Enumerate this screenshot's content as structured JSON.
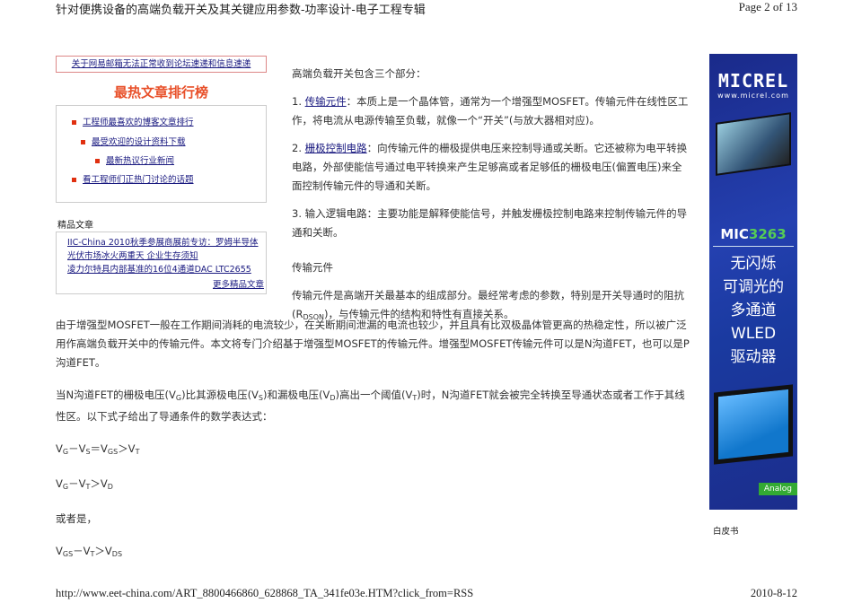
{
  "header": {
    "title": "针对便携设备的高端负载开关及其关键应用参数-功率设计-电子工程专辑",
    "page": "Page 2 of 13"
  },
  "footer": {
    "url": "http://www.eet-china.com/ART_8800466860_628868_TA_341fe03e.HTM?click_from=RSS",
    "date": "2010-8-12"
  },
  "sidebar": {
    "notice": "关于网易邮箱无法正常收到论坛速递和信息速递",
    "hot_title": "最热文章排行榜",
    "hot_items": [
      "工程师最喜欢的博客文章排行",
      "最受欢迎的设计资料下载",
      "最新热议行业新闻",
      "看工程师们正热门讨论的话题"
    ],
    "featured_label": "精品文章",
    "featured_items": [
      "IIC-China 2010秋季参展商展前专访：罗姆半导体",
      "光伏市场冰火两重天 企业生存须知",
      "凌力尔特具内部基准的16位4通道DAC LTC2655"
    ],
    "more_link": "更多精品文章"
  },
  "main": {
    "intro": "高端负载开关包含三个部分：",
    "p1_num": "1. ",
    "p1_link": "传输元件",
    "p1_text": "：本质上是一个晶体管，通常为一个增强型MOSFET。传输元件在线性区工作，将电流从电源传输至负载，就像一个“开关”(与放大器相对应)。",
    "p2_num": "2. ",
    "p2_link": "栅极控制电路",
    "p2_text": "：向传输元件的栅极提供电压来控制导通或关断。它还被称为电平转换电路，外部使能信号通过电平转换来产生足够高或者足够低的栅极电压(偏置电压)来全面控制传输元件的导通和关断。",
    "p3": "3. 输入逻辑电路：主要功能是解释使能信号，并触发栅极控制电路来控制传输元件的导通和关断。",
    "heading": "传输元件",
    "p4a": "传输元件是高端开关最基本的组成部分。最经常考虑的参数，特别是开关导通时的阻抗(R",
    "p4sub": "DSON",
    "p4b": ")，与传输元件的结构和特性有直接关系。",
    "p5": "由于增强型MOSFET一般在工作期间消耗的电流较少，在关断期间泄漏的电流也较少，并且具有比双极晶体管更高的热稳定性，所以被广泛用作高端负载开关中的传输元件。本文将专门介绍基于增强型MOSFET的传输元件。增强型MOSFET传输元件可以是N沟道FET，也可以是P沟道FET。",
    "p6": [
      "当N沟道FET的栅极电压(V",
      "G",
      ")比其源极电压(V",
      "S",
      ")和漏极电压(V",
      "D",
      ")高出一个阈值(V",
      "T",
      ")时，N沟道FET就会被完全转换至导通状态或者工作于其线性区。以下式子给出了导通条件的数学表达式："
    ],
    "f1": [
      "V",
      "G",
      "－V",
      "S",
      "＝V",
      "GS",
      "＞V",
      "T"
    ],
    "f2": [
      "V",
      "G",
      "－V",
      "T",
      "＞V",
      "D"
    ],
    "or": "或者是，",
    "f3": [
      "V",
      "GS",
      "－V",
      "T",
      "＞V",
      "DS"
    ]
  },
  "ad": {
    "brand": "MICREL",
    "url": "www.micrel.com",
    "model_a": "MIC",
    "model_b": "3263",
    "slogan": [
      "无闪烁",
      "可调光的",
      "多通道",
      "WLED",
      "驱动器"
    ],
    "tag": "Analog"
  },
  "whitepaper": "白皮书"
}
